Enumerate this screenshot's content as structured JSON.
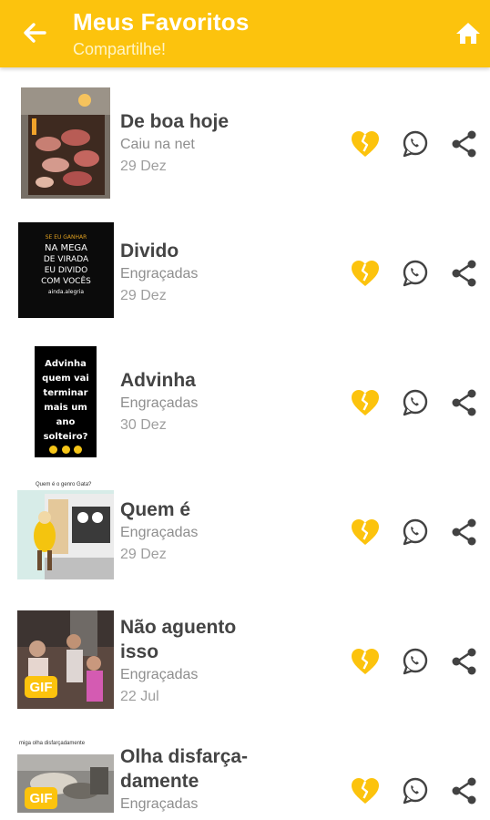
{
  "header": {
    "title": "Meus Favoritos",
    "subtitle": "Compartilhe!",
    "back_icon": "arrow-left-icon",
    "home_icon": "home-icon",
    "background_color": "#fcc30d"
  },
  "actions": {
    "favorite_icon": "broken-heart-icon",
    "whatsapp_icon": "whatsapp-icon",
    "share_icon": "share-icon",
    "favorite_color": "#fcc30d"
  },
  "items": [
    {
      "title": "De boa hoje",
      "category": "Caiu na net",
      "date": "29 Dez"
    },
    {
      "title": "Divido",
      "category": "Engraçadas",
      "date": "29 Dez",
      "thumb_lines": [
        "SE EU GANHAR",
        "NA MEGA",
        "DE VIRADA",
        "EU DIVIDO",
        "COM VOCÊS",
        "ainda.alegria"
      ]
    },
    {
      "title": "Advinha",
      "category": "Engraçadas",
      "date": "30 Dez",
      "thumb_lines": [
        "Advinha",
        "quem vai",
        "terminar",
        "mais um",
        "ano",
        "solteiro?"
      ]
    },
    {
      "title": "Quem é",
      "category": "Engraçadas",
      "date": "29 Dez",
      "thumb_caption": "Quem é o genro Gata?"
    },
    {
      "title_line1": "Não aguento",
      "title_line2": "isso",
      "category": "Engraçadas",
      "date": "22 Jul",
      "badge": "GIF"
    },
    {
      "title_line1": "Olha disfarça-",
      "title_line2": "damente",
      "category": "Engraçadas",
      "badge": "GIF",
      "thumb_caption": "miga olha disfarçadamente"
    }
  ]
}
